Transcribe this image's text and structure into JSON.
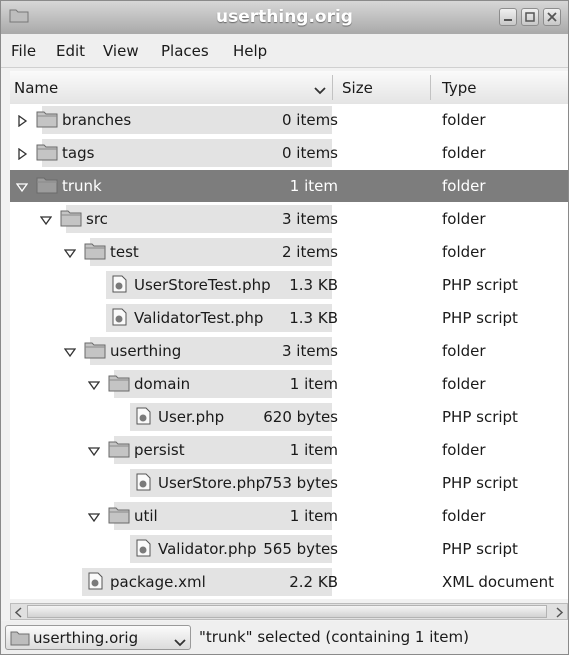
{
  "window": {
    "title": "userthing.orig"
  },
  "menu": [
    "File",
    "Edit",
    "View",
    "Places",
    "Help"
  ],
  "columns": {
    "name": "Name",
    "size": "Size",
    "type": "Type"
  },
  "rows": [
    {
      "name": "branches",
      "size": "0 items",
      "type": "folder",
      "kind": "folder",
      "depth": 0,
      "state": "collapsed"
    },
    {
      "name": "tags",
      "size": "0 items",
      "type": "folder",
      "kind": "folder",
      "depth": 0,
      "state": "collapsed"
    },
    {
      "name": "trunk",
      "size": "1 item",
      "type": "folder",
      "kind": "folder",
      "depth": 0,
      "state": "expanded",
      "selected": true
    },
    {
      "name": "src",
      "size": "3 items",
      "type": "folder",
      "kind": "folder",
      "depth": 1,
      "state": "expanded"
    },
    {
      "name": "test",
      "size": "2 items",
      "type": "folder",
      "kind": "folder",
      "depth": 2,
      "state": "expanded"
    },
    {
      "name": "UserStoreTest.php",
      "size": "1.3 KB",
      "type": "PHP script",
      "kind": "file",
      "depth": 3
    },
    {
      "name": "ValidatorTest.php",
      "size": "1.3 KB",
      "type": "PHP script",
      "kind": "file",
      "depth": 3
    },
    {
      "name": "userthing",
      "size": "3 items",
      "type": "folder",
      "kind": "folder",
      "depth": 2,
      "state": "expanded"
    },
    {
      "name": "domain",
      "size": "1 item",
      "type": "folder",
      "kind": "folder",
      "depth": 3,
      "state": "expanded"
    },
    {
      "name": "User.php",
      "size": "620 bytes",
      "type": "PHP script",
      "kind": "file",
      "depth": 4
    },
    {
      "name": "persist",
      "size": "1 item",
      "type": "folder",
      "kind": "folder",
      "depth": 3,
      "state": "expanded"
    },
    {
      "name": "UserStore.php",
      "size": "753 bytes",
      "type": "PHP script",
      "kind": "file",
      "depth": 4
    },
    {
      "name": "util",
      "size": "1 item",
      "type": "folder",
      "kind": "folder",
      "depth": 3,
      "state": "expanded"
    },
    {
      "name": "Validator.php",
      "size": "565 bytes",
      "type": "PHP script",
      "kind": "file",
      "depth": 4
    },
    {
      "name": "package.xml",
      "size": "2.2 KB",
      "type": "XML document",
      "kind": "file",
      "depth": 2
    }
  ],
  "statusbar": {
    "location": "userthing.orig",
    "text": "\"trunk\" selected (containing 1 item)"
  }
}
